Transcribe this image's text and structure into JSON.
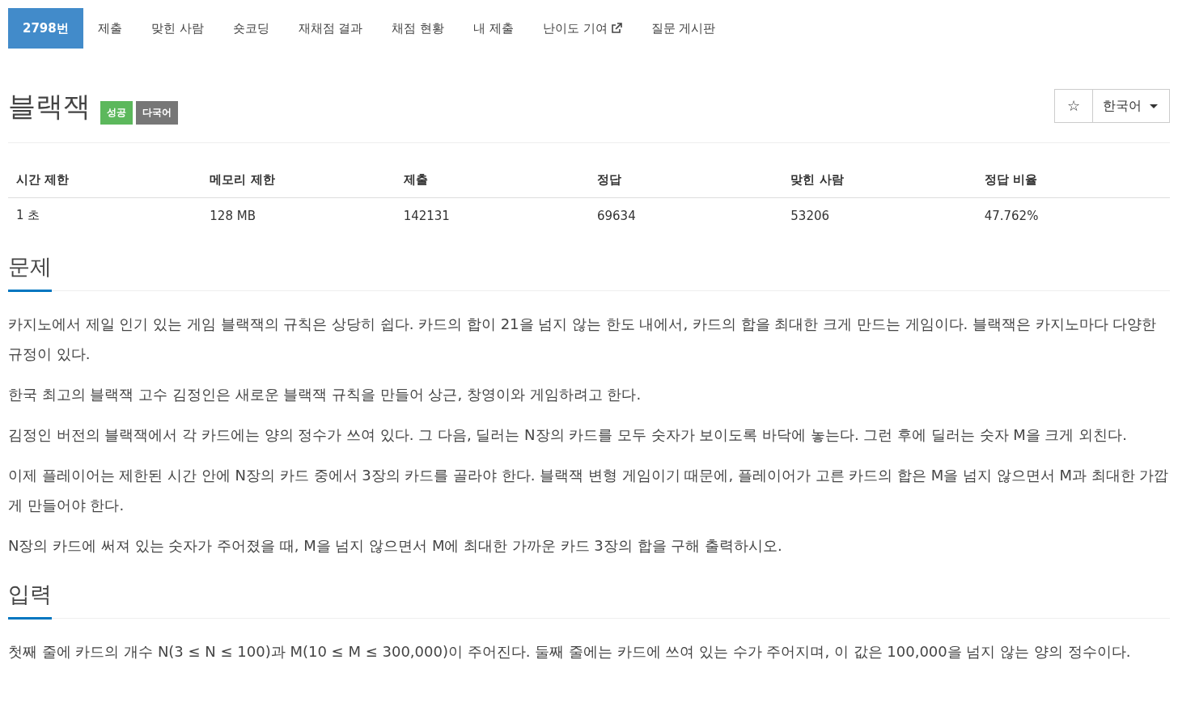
{
  "tabs": [
    {
      "label": "2798번",
      "selected": true,
      "external": false
    },
    {
      "label": "제출",
      "selected": false,
      "external": false
    },
    {
      "label": "맞힌 사람",
      "selected": false,
      "external": false
    },
    {
      "label": "숏코딩",
      "selected": false,
      "external": false
    },
    {
      "label": "재채점 결과",
      "selected": false,
      "external": false
    },
    {
      "label": "채점 현황",
      "selected": false,
      "external": false
    },
    {
      "label": "내 제출",
      "selected": false,
      "external": false
    },
    {
      "label": "난이도 기여",
      "selected": false,
      "external": true
    },
    {
      "label": "질문 게시판",
      "selected": false,
      "external": false
    }
  ],
  "problem": {
    "title": "블랙잭",
    "badges": [
      {
        "label": "성공",
        "color": "#5cb85c"
      },
      {
        "label": "다국어",
        "color": "#777777"
      }
    ],
    "star": "☆",
    "language": "한국어"
  },
  "stats": {
    "columns": [
      "시간 제한",
      "메모리 제한",
      "제출",
      "정답",
      "맞힌 사람",
      "정답 비율"
    ],
    "row": [
      "1 초",
      "128 MB",
      "142131",
      "69634",
      "53206",
      "47.762%"
    ]
  },
  "sections": [
    {
      "heading": "문제",
      "paragraphs": [
        "카지노에서 제일 인기 있는 게임 블랙잭의 규칙은 상당히 쉽다. 카드의 합이 21을 넘지 않는 한도 내에서, 카드의 합을 최대한 크게 만드는 게임이다. 블랙잭은 카지노마다 다양한 규정이 있다.",
        "한국 최고의 블랙잭 고수 김정인은 새로운 블랙잭 규칙을 만들어 상근, 창영이와 게임하려고 한다.",
        "김정인 버전의 블랙잭에서 각 카드에는 양의 정수가 쓰여 있다. 그 다음, 딜러는 N장의 카드를 모두 숫자가 보이도록 바닥에 놓는다. 그런 후에 딜러는 숫자 M을 크게 외친다.",
        "이제 플레이어는 제한된 시간 안에 N장의 카드 중에서 3장의 카드를 골라야 한다. 블랙잭 변형 게임이기 때문에, 플레이어가 고른 카드의 합은 M을 넘지 않으면서 M과 최대한 가깝게 만들어야 한다.",
        "N장의 카드에 써져 있는 숫자가 주어졌을 때, M을 넘지 않으면서 M에 최대한 가까운 카드 3장의 합을 구해 출력하시오."
      ]
    },
    {
      "heading": "입력",
      "paragraphs": [
        "첫째 줄에 카드의 개수 N(3 ≤ N ≤ 100)과 M(10 ≤ M ≤ 300,000)이 주어진다. 둘째 줄에는 카드에 쓰여 있는 수가 주어지며, 이 값은 100,000을 넘지 않는 양의 정수이다."
      ]
    }
  ]
}
